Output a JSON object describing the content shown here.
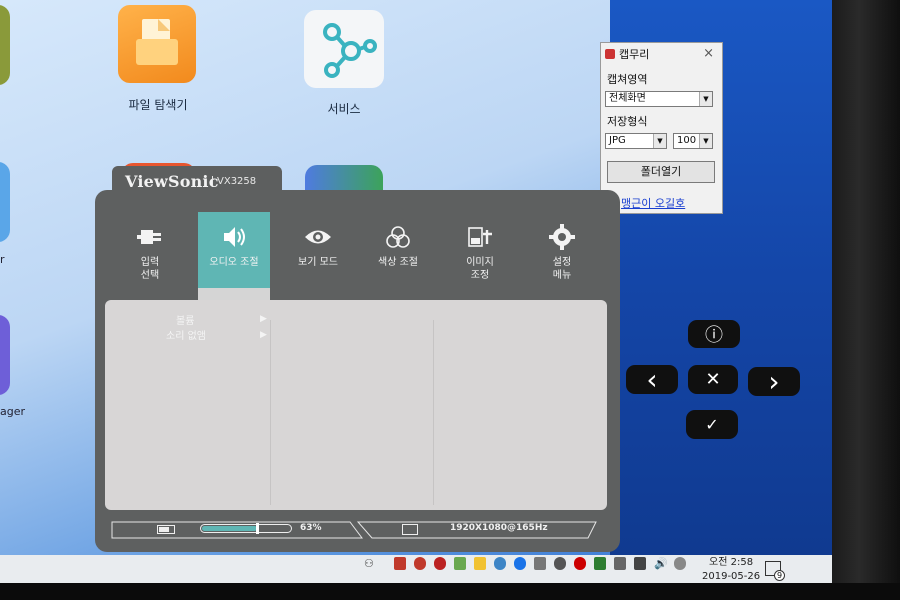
{
  "desktop": {
    "icons": [
      {
        "label": "파일 탐색기"
      },
      {
        "label": "서비스"
      }
    ],
    "edge_labels": [
      "r",
      "ager"
    ]
  },
  "capture_window": {
    "title": "캡무리",
    "area_label": "캡쳐영역",
    "area_value": "전체화면",
    "format_label": "저장형식",
    "format_value": "JPG",
    "quality_value": "100",
    "open_folder_button": "폴더열기",
    "link_text": "맹근이 오길호"
  },
  "osd": {
    "brand": "ViewSonic",
    "model": "VX3258",
    "menu": [
      {
        "label": "입력\n선택",
        "icon": "input-icon"
      },
      {
        "label": "오디오 조절",
        "icon": "audio-icon",
        "active": true
      },
      {
        "label": "보기 모드",
        "icon": "eye-icon"
      },
      {
        "label": "색상 조절",
        "icon": "color-icon"
      },
      {
        "label": "이미지\n조정",
        "icon": "image-adjust-icon"
      },
      {
        "label": "설정\n메뉴",
        "icon": "gear-icon"
      }
    ],
    "submenu": [
      {
        "label": "볼륨"
      },
      {
        "label": "소리 없앰"
      }
    ],
    "status": {
      "volume_percent": "63%",
      "volume_fraction": 0.63,
      "resolution": "1920X1080@165Hz"
    }
  },
  "nav_keys": {
    "info": "ⓘ",
    "left": "‹",
    "close": "✕",
    "right": "›",
    "confirm": "✓"
  },
  "taskbar": {
    "clock_period": "오전 2:58",
    "date": "2019-05-26",
    "notification_count": "9"
  },
  "colors": {
    "osd_bg": "#5e6060",
    "accent": "#5fb6b4",
    "panel": "#d8d6d6"
  }
}
